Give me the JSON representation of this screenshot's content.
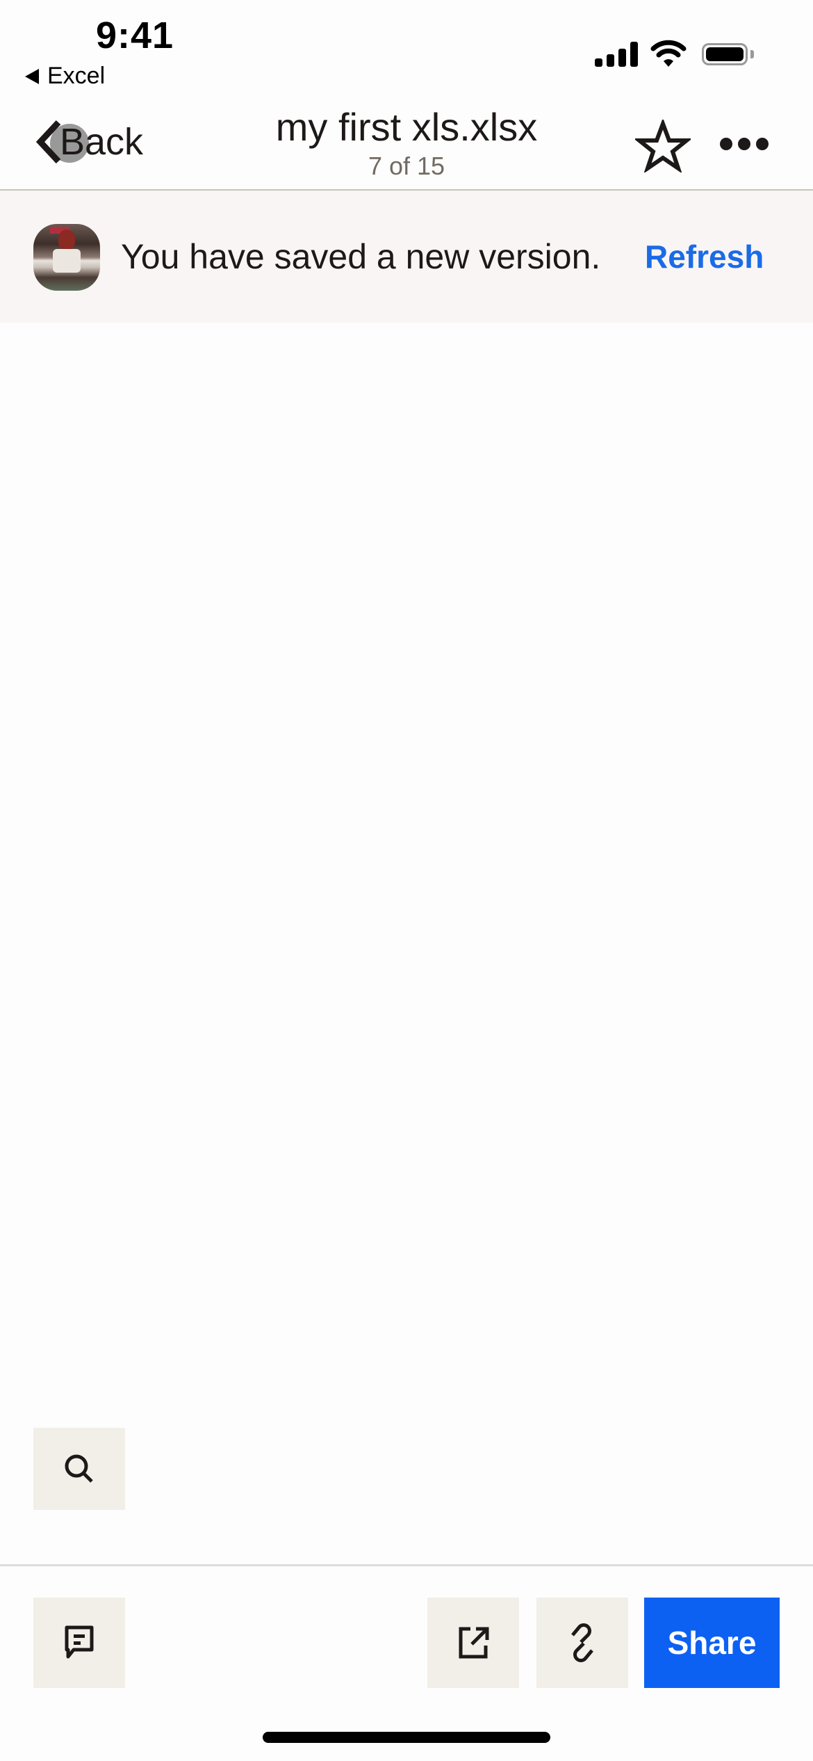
{
  "status_bar": {
    "time": "9:41",
    "back_app_label": "Excel",
    "icons": [
      "signal-icon",
      "wifi-icon",
      "battery-icon"
    ]
  },
  "header": {
    "back_label": "Back",
    "title": "my first xls.xlsx",
    "subtitle": "7 of 15",
    "icons": [
      "chevron-left-icon",
      "star-icon",
      "more-icon"
    ]
  },
  "banner": {
    "message": "You have saved a new version.",
    "action_label": "Refresh",
    "action_color": "#1a6be6"
  },
  "toolbar": {
    "search_icon": "search-icon",
    "comment_icon": "comment-icon",
    "open_external_icon": "open-external-icon",
    "link_icon": "link-icon",
    "share_label": "Share",
    "share_color": "#0d61f2"
  }
}
